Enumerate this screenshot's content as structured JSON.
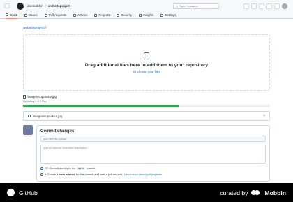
{
  "header": {
    "owner": "doemobbin",
    "separator": "/",
    "repo": "websiteproject",
    "search_placeholder": "Type / to search"
  },
  "tabs": [
    {
      "label": "Code",
      "icon": "code-icon"
    },
    {
      "label": "Issues",
      "icon": "issue-icon"
    },
    {
      "label": "Pull requests",
      "icon": "pull-request-icon"
    },
    {
      "label": "Actions",
      "icon": "play-icon"
    },
    {
      "label": "Projects",
      "icon": "table-icon"
    },
    {
      "label": "Security",
      "icon": "shield-icon"
    },
    {
      "label": "Insights",
      "icon": "graph-icon"
    },
    {
      "label": "Settings",
      "icon": "gear-icon"
    }
  ],
  "repo_path": {
    "repo": "websiteproject",
    "slash": "/"
  },
  "dropzone": {
    "title": "Drag additional files here to add them to your repository",
    "link": "Or choose your files"
  },
  "upload": {
    "file_path": "/images/cupcake2.jpg",
    "progress_text": "Uploading 2 of 2 files",
    "progress_fraction": 0.63
  },
  "file_list": {
    "file_path": "/images/cupcake2.jpg",
    "close": "×"
  },
  "commit": {
    "title": "Commit changes",
    "summary_placeholder": "Add files via upload",
    "description_placeholder": "Add an optional extended description...",
    "option1_prefix": "Commit directly to the",
    "option1_branch": "main",
    "option1_suffix": "branch.",
    "option2_prefix": "Create a",
    "option2_bold": "new branch",
    "option2_middle": "for this commit and start a pull request.",
    "option2_link": "Learn more about pull requests."
  },
  "footer": {
    "left_label": "GitHub",
    "right_prefix": "curated by",
    "right_brand": "Mobbin"
  }
}
